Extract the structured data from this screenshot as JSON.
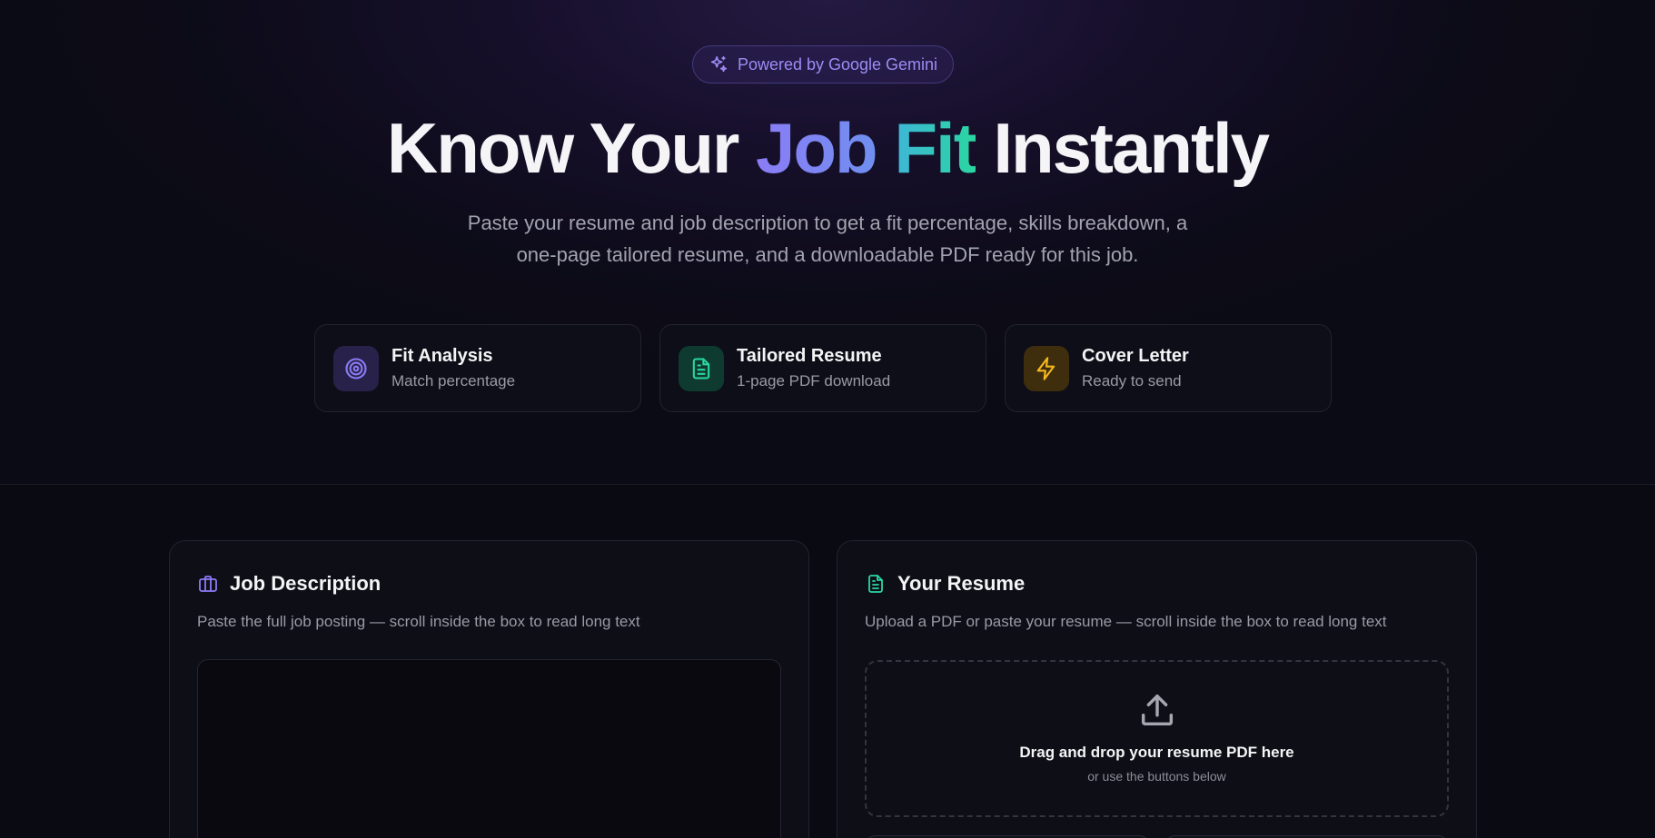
{
  "hero": {
    "badge_label": "Powered by Google Gemini",
    "headline": {
      "part1": "Know Your",
      "job": "Job",
      "fit": "Fit",
      "part2": "Instantly"
    },
    "subtitle_line1": "Paste your resume and job description to get a fit percentage, skills breakdown, a",
    "subtitle_line2": "one-page tailored resume, and a downloadable PDF ready for this job."
  },
  "features": [
    {
      "title": "Fit Analysis",
      "subtitle": "Match percentage",
      "icon": "target-icon",
      "color": "#8b7cf6"
    },
    {
      "title": "Tailored Resume",
      "subtitle": "1-page PDF download",
      "icon": "document-icon",
      "color": "#2ad6a0"
    },
    {
      "title": "Cover Letter",
      "subtitle": "Ready to send",
      "icon": "lightning-icon",
      "color": "#f5b81c"
    }
  ],
  "job_panel": {
    "title": "Job Description",
    "description": "Paste the full job posting — scroll inside the box to read long text",
    "textarea_value": ""
  },
  "resume_panel": {
    "title": "Your Resume",
    "description": "Upload a PDF or paste your resume — scroll inside the box to read long text",
    "dropzone_title": "Drag and drop your resume PDF here",
    "dropzone_subtitle": "or use the buttons below"
  },
  "colors": {
    "accent_purple": "#8b7cf6",
    "accent_green": "#2ad6a0",
    "accent_amber": "#f5b81c",
    "background": "#0a0a12"
  }
}
